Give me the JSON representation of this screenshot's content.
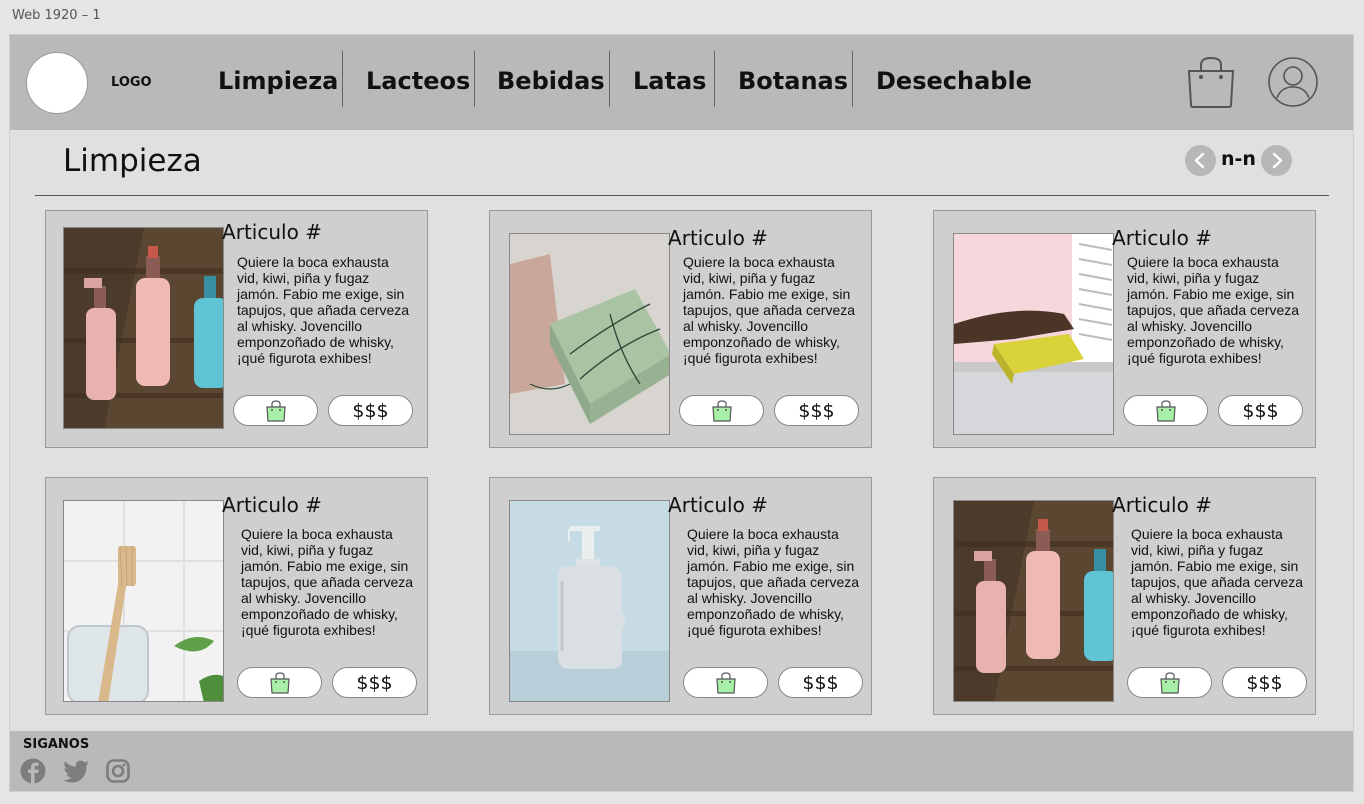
{
  "frame_label": "Web 1920 – 1",
  "header": {
    "logo_label": "LOGO",
    "nav": [
      "Limpieza",
      "Lacteos",
      "Bebidas",
      "Latas",
      "Botanas",
      "Desechable"
    ],
    "cart_icon": "shopping-bag-icon",
    "profile_icon": "user-icon"
  },
  "section": {
    "title": "Limpieza",
    "pager": "n-n"
  },
  "products": [
    {
      "title": "Articulo #",
      "desc": "Quiere la boca exhausta vid, kiwi, piña y fugaz jamón. Fabio me exige, sin tapujos, que añada cerveza al whisky. Jovencillo emponzoñado de whisky, ¡qué figurota exhibes!",
      "price": "$$$",
      "image": "hair-care-bottles"
    },
    {
      "title": "Articulo #",
      "desc": "Quiere la boca exhausta vid, kiwi, piña y fugaz jamón. Fabio me exige, sin tapujos, que añada cerveza al whisky. Jovencillo emponzoñado de whisky, ¡qué figurota exhibes!",
      "price": "$$$",
      "image": "handmade-soap-bars"
    },
    {
      "title": "Articulo #",
      "desc": "Quiere la boca exhausta vid, kiwi, piña y fugaz jamón. Fabio me exige, sin tapujos, que añada cerveza al whisky. Jovencillo emponzoñado de whisky, ¡qué figurota exhibes!",
      "price": "$$$",
      "image": "cleaning-sponge"
    },
    {
      "title": "Articulo #",
      "desc": "Quiere la boca exhausta vid, kiwi, piña y fugaz jamón. Fabio me exige, sin tapujos, que añada cerveza al whisky. Jovencillo emponzoñado de whisky, ¡qué figurota exhibes!",
      "price": "$$$",
      "image": "bamboo-toothbrush"
    },
    {
      "title": "Articulo #",
      "desc": "Quiere la boca exhausta vid, kiwi, piña y fugaz jamón. Fabio me exige, sin tapujos, que añada cerveza al whisky. Jovencillo emponzoñado de whisky, ¡qué figurota exhibes!",
      "price": "$$$",
      "image": "soap-dispenser"
    },
    {
      "title": "Articulo #",
      "desc": "Quiere la boca exhausta vid, kiwi, piña y fugaz jamón. Fabio me exige, sin tapujos, que añada cerveza al whisky. Jovencillo emponzoñado de whisky, ¡qué figurota exhibes!",
      "price": "$$$",
      "image": "hair-care-bottles"
    }
  ],
  "footer": {
    "title": "SIGANOS",
    "social": [
      "facebook-icon",
      "twitter-icon",
      "instagram-icon"
    ]
  },
  "colors": {
    "header_bg": "#b9b9b9",
    "page_bg": "#e0e0e0",
    "card_bg": "#cfcfcf",
    "cart_icon_green": "#a8f0a8"
  }
}
